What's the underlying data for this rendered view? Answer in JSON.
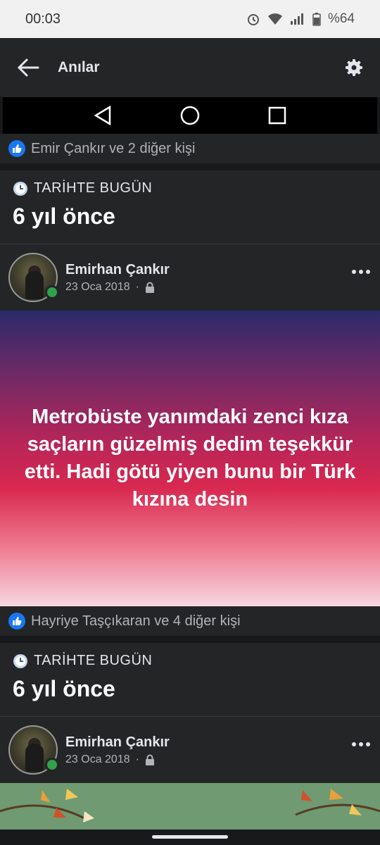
{
  "status": {
    "time": "00:03",
    "battery": "%64"
  },
  "appbar": {
    "title": "Anılar"
  },
  "posts": [
    {
      "likes": "Emir Çankır ve 2 diğer kişi"
    },
    {
      "memory_label": "TARİHTE BUGÜN",
      "memory_years": "6 yıl önce",
      "author": "Emirhan Çankır",
      "date": "23 Oca 2018",
      "text": "Metrobüste yanımdaki zenci kıza saçların güzelmiş dedim teşekkür etti. Hadi götü yiyen bunu bir Türk kızına desin",
      "likes": "Hayriye Taşçıkaran ve 4 diğer kişi"
    },
    {
      "memory_label": "TARİHTE BUGÜN",
      "memory_years": "6 yıl önce",
      "author": "Emirhan Çankır",
      "date": "23 Oca 2018"
    }
  ],
  "colors": {
    "accent": "#1877f2",
    "online": "#31a24c",
    "background": "#18191a",
    "card": "#242526"
  }
}
